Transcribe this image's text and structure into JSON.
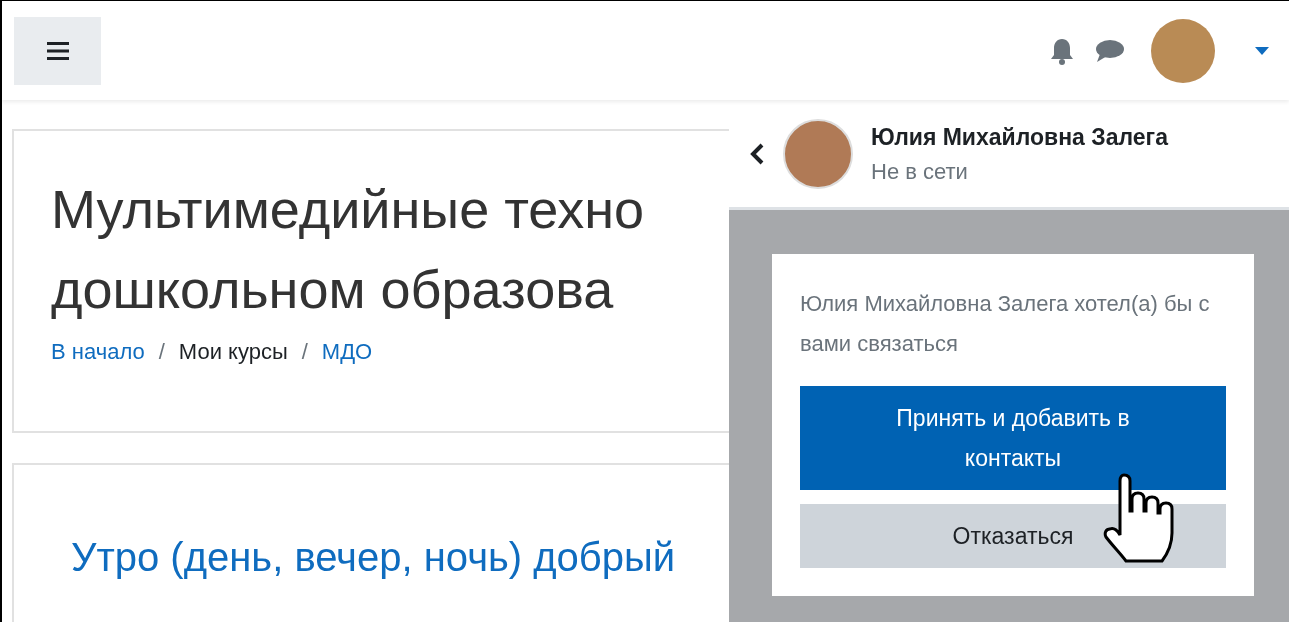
{
  "page_header": {
    "title_lines": [
      "Мультимедийные техно",
      "дошкольном образова"
    ],
    "breadcrumb": [
      {
        "label": "В начало",
        "kind": "link"
      },
      {
        "label": "Мои курсы",
        "kind": "text"
      },
      {
        "label": "МДО",
        "kind": "link"
      }
    ],
    "separator": "/"
  },
  "section": {
    "title": "Утро (день, вечер, ночь) добрый"
  },
  "drawer": {
    "contact": {
      "name": "Юлия Михайловна Залега",
      "status": "Не в сети"
    },
    "request": {
      "message": "Юлия Михайловна Залега хотел(а) бы с вами связаться",
      "accept_label": "Принять и добавить в контакты",
      "decline_label": "Отказаться"
    }
  }
}
